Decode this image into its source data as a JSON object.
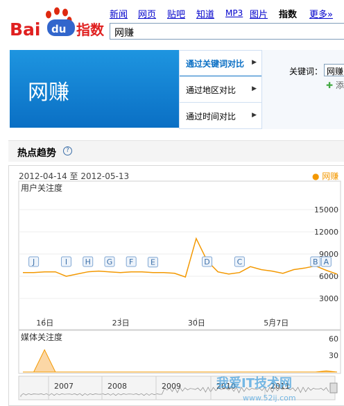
{
  "logo": {
    "text": "Bai",
    "du": "du",
    "suffix": "指数"
  },
  "nav": [
    {
      "label": "新闻",
      "active": false
    },
    {
      "label": "网页",
      "active": false
    },
    {
      "label": "贴吧",
      "active": false
    },
    {
      "label": "知道",
      "active": false
    },
    {
      "label": "MP3",
      "active": false
    },
    {
      "label": "图片",
      "active": false
    },
    {
      "label": "指数",
      "active": true
    },
    {
      "label": "更多»",
      "active": false
    }
  ],
  "search": {
    "value": "网赚"
  },
  "banner": {
    "word": "网赚"
  },
  "tabs": [
    {
      "label": "通过关键词对比",
      "active": true
    },
    {
      "label": "通过地区对比",
      "active": false
    },
    {
      "label": "通过时间对比",
      "active": false
    }
  ],
  "keyword_panel": {
    "label": "关键词：",
    "value": "网赚",
    "add_label": "添"
  },
  "section": {
    "title": "热点趋势",
    "help": "?"
  },
  "chart_data": [
    {
      "type": "line",
      "title": "用户关注度",
      "date_range": "2012-04-14 至 2012-05-13",
      "legend": "网赚",
      "color": "#f39800",
      "ylim": [
        0,
        15000
      ],
      "yticks": [
        "15000",
        "12000",
        "9000",
        "6000",
        "3000"
      ],
      "xticks": [
        "16日",
        "23日",
        "30日",
        "5月7日"
      ],
      "x": [
        "04-14",
        "04-15",
        "04-16",
        "04-17",
        "04-18",
        "04-19",
        "04-20",
        "04-21",
        "04-22",
        "04-23",
        "04-24",
        "04-25",
        "04-26",
        "04-27",
        "04-28",
        "04-29",
        "04-30",
        "05-01",
        "05-02",
        "05-03",
        "05-04",
        "05-05",
        "05-06",
        "05-07",
        "05-08",
        "05-09",
        "05-10",
        "05-11",
        "05-12",
        "05-13"
      ],
      "values": [
        6400,
        6400,
        6500,
        6500,
        5900,
        6200,
        6500,
        6600,
        6500,
        6400,
        6500,
        6500,
        6400,
        6400,
        6300,
        5800,
        11000,
        8000,
        6500,
        6200,
        6400,
        7200,
        6800,
        6600,
        6300,
        6800,
        7000,
        7300,
        6700,
        6200
      ],
      "events": [
        {
          "label": "J",
          "date": "04-15"
        },
        {
          "label": "I",
          "date": "04-18"
        },
        {
          "label": "H",
          "date": "04-20"
        },
        {
          "label": "G",
          "date": "04-22"
        },
        {
          "label": "F",
          "date": "04-24"
        },
        {
          "label": "E",
          "date": "04-26"
        },
        {
          "label": "D",
          "date": "05-01"
        },
        {
          "label": "C",
          "date": "05-04"
        },
        {
          "label": "B",
          "date": "05-11"
        },
        {
          "label": "A",
          "date": "05-12"
        }
      ]
    },
    {
      "type": "area",
      "title": "媒体关注度",
      "color": "#f39800",
      "ylim": [
        0,
        60
      ],
      "yticks": [
        "60",
        "30"
      ],
      "x": [
        "04-14",
        "04-15",
        "04-16",
        "04-17",
        "04-18",
        "04-19",
        "04-20",
        "04-21",
        "04-22",
        "04-23",
        "04-24",
        "04-25",
        "04-26",
        "04-27",
        "04-28",
        "04-29",
        "04-30",
        "05-01",
        "05-02",
        "05-03",
        "05-04",
        "05-05",
        "05-06",
        "05-07",
        "05-08",
        "05-09",
        "05-10",
        "05-11",
        "05-12",
        "05-13"
      ],
      "values": [
        0,
        0,
        40,
        0,
        0,
        0,
        0,
        0,
        0,
        0,
        0,
        0,
        0,
        0,
        0,
        0,
        0,
        0,
        0,
        0,
        0,
        0,
        0,
        0,
        0,
        0,
        0,
        0,
        2,
        0
      ]
    }
  ],
  "timeline": {
    "years": [
      "2007",
      "2008",
      "2009",
      "2010",
      "2011"
    ]
  },
  "watermark": {
    "text": "我爱IT技术网",
    "url": "www.52ij.com"
  }
}
